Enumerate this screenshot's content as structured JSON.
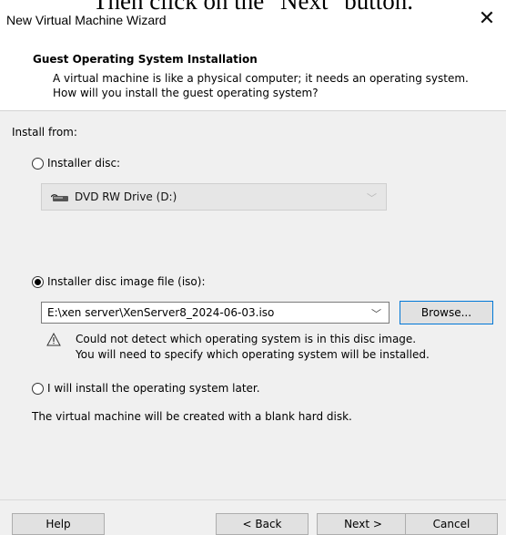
{
  "caption": "Then click on the \"Next\" button.",
  "window": {
    "title": "New Virtual Machine Wizard",
    "close_symbol": "✕"
  },
  "header": {
    "title": "Guest Operating System Installation",
    "description": "A virtual machine is like a physical computer; it needs an operating system. How will you install the guest operating system?"
  },
  "main": {
    "install_from_label": "Install from:",
    "options": [
      {
        "label": "Installer disc:",
        "selected": false
      },
      {
        "label": "Installer disc image file (iso):",
        "selected": true
      },
      {
        "label": "I will install the operating system later.",
        "selected": false
      }
    ],
    "disc_select": {
      "value": "DVD RW Drive (D:)",
      "icon": "dvd-drive-icon",
      "enabled": false
    },
    "iso_path": {
      "value": "E:\\xen server\\XenServer8_2024-06-03.iso"
    },
    "browse_label": "Browse...",
    "warning_line1": "Could not detect which operating system is in this disc image.",
    "warning_line2": "You will need to specify which operating system will be installed.",
    "later_description": "The virtual machine will be created with a blank hard disk."
  },
  "footer": {
    "help": "Help",
    "back": "< Back",
    "next": "Next >",
    "cancel": "Cancel"
  }
}
